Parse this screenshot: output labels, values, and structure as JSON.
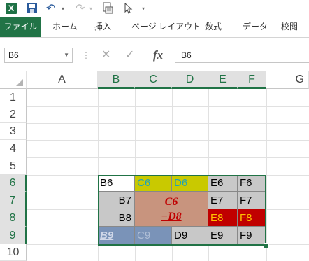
{
  "quick_access": {
    "app_logo": "X",
    "icons": [
      "excel-logo-icon",
      "save-icon",
      "undo-icon",
      "redo-icon",
      "print-preview-icon",
      "cursor-icon"
    ]
  },
  "ribbon": {
    "file": "ファイル",
    "home": "ホーム",
    "insert": "挿入",
    "page_layout": "ページ レイアウト",
    "formulas": "数式",
    "data": "データ",
    "review": "校閲"
  },
  "formula_bar": {
    "name_box": "B6",
    "fx": "fx",
    "value": "B6"
  },
  "grid": {
    "columns": [
      "A",
      "B",
      "C",
      "D",
      "E",
      "F",
      "G"
    ],
    "rows": [
      "1",
      "2",
      "3",
      "4",
      "5",
      "6",
      "7",
      "8",
      "9",
      "10"
    ],
    "cells": {
      "B6": "B6",
      "C6": "C6",
      "D6": "D6",
      "E6": "E6",
      "F6": "F6",
      "B7": "B7",
      "E7": "E7",
      "F7": "F7",
      "B8": "B8",
      "E8": "E8",
      "F8": "F8",
      "B9": "B9",
      "C9": "C9",
      "D9": "D9",
      "E9": "E9",
      "F9": "F9"
    },
    "merged": {
      "line1": "C6",
      "line2": "−D8"
    }
  },
  "colors": {
    "brand": "#217346",
    "olive": "#c9c900",
    "tan": "#c8947e",
    "red": "#c00000",
    "slate": "#7a93b8",
    "gray": "#c8c8c8"
  }
}
